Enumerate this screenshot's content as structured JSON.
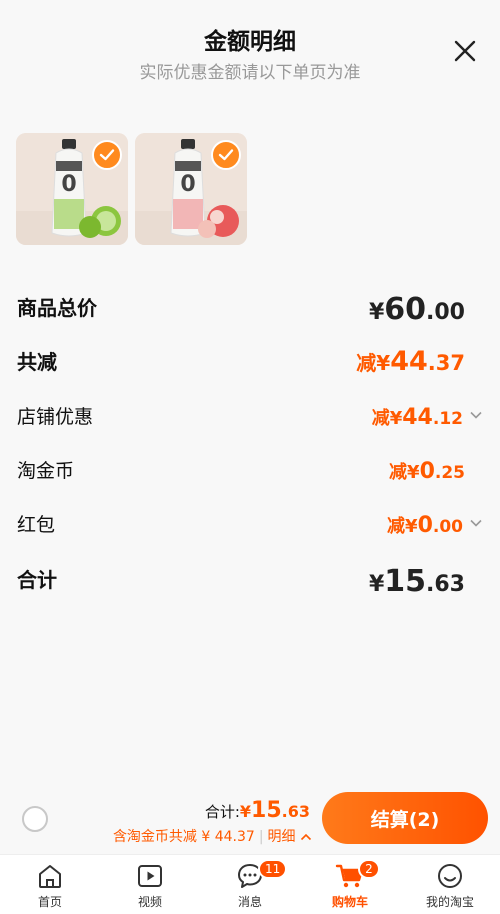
{
  "header": {
    "title": "金额明细",
    "subtitle": "实际优惠金额请以下单页为准"
  },
  "rows": {
    "goods_total": {
      "label": "商品总价",
      "yen": "¥",
      "int": "60",
      "dec": ".00"
    },
    "total_discount": {
      "label": "共减",
      "prefix": "减",
      "yen": "¥",
      "int": "44",
      "dec": ".37"
    },
    "shop_discount": {
      "label": "店铺优惠",
      "prefix": "减",
      "yen": "¥",
      "int": "44",
      "dec": ".12"
    },
    "taojinbi": {
      "label": "淘金币",
      "prefix": "减",
      "yen": "¥",
      "int": "0",
      "dec": ".25"
    },
    "hongbao": {
      "label": "红包",
      "prefix": "减",
      "yen": "¥",
      "int": "0",
      "dec": ".00"
    },
    "subtotal": {
      "label": "合计",
      "yen": "¥",
      "int": "15",
      "dec": ".63"
    }
  },
  "bottom": {
    "total_label": "合计:",
    "yen": "¥",
    "int": "15",
    "dec": ".63",
    "discount_text": "含淘金币共减 ¥ 44.37",
    "detail_label": "明细",
    "checkout_label": "结算(2)"
  },
  "tabs": [
    {
      "label": "首页"
    },
    {
      "label": "视频"
    },
    {
      "label": "消息",
      "badge": "11"
    },
    {
      "label": "购物车",
      "badge": "2"
    },
    {
      "label": "我的淘宝"
    }
  ],
  "colors": {
    "accent": "#ff5a00",
    "check": "#ff8a1e"
  }
}
